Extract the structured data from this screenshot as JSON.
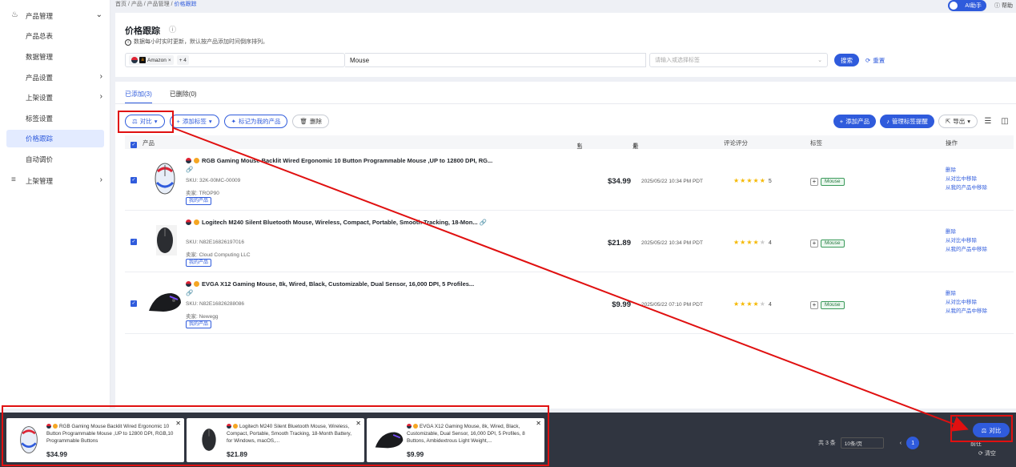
{
  "sidebar": {
    "group_top": {
      "label": "产品管理"
    },
    "items": [
      {
        "label": "产品总表"
      },
      {
        "label": "数据管理"
      },
      {
        "label": "产品设置"
      },
      {
        "label": "上架设置"
      },
      {
        "label": "标签设置"
      },
      {
        "label": "价格跟踪"
      },
      {
        "label": "自动调价"
      }
    ],
    "group_bottom": {
      "label": "上架管理"
    }
  },
  "breadcrumb": {
    "text": "首页 / 产品 / 产品管理 / ",
    "current": "价格跟踪"
  },
  "topright": {
    "ai_label": "AI助手",
    "help_label": "帮助"
  },
  "header": {
    "title": "价格跟踪",
    "notice": "数据每小时实时更新，默认按产品添加时间倒序排列。",
    "site_chip": "Amazon",
    "site_more": "+ 4",
    "keyword": "Mouse",
    "tag_placeholder": "请输入或选择标签",
    "search_label": "搜索",
    "reset_label": "重置"
  },
  "tabs": [
    {
      "label": "已添加(3)"
    },
    {
      "label": "已删除(0)"
    }
  ],
  "toolbar": {
    "compare_label": "对比",
    "add_tag_label": "添加标签",
    "mark_mine_label": "标记为我的产品",
    "delete_label": "删除",
    "add_product_label": "添加产品",
    "manage_alert_label": "管理标签提醒",
    "export_label": "导出"
  },
  "table": {
    "headers": {
      "product": "产品",
      "price": "当前价格",
      "time": "最后价格变动时间",
      "rating": "评论评分",
      "tags": "标签",
      "ops": "操作"
    },
    "rows": [
      {
        "title": "RGB Gaming Mouse Backlit Wired Ergonomic 10 Button Programmable Mouse ,UP to 12800 DPI, RG...",
        "sku": "SKU: 32K-00MC-00009",
        "seller": "卖家: TROP90",
        "mine": "我的产品",
        "price": "$34.99",
        "time": "2025/05/22 10:34 PM PDT",
        "rating": 5,
        "rating_label": "5",
        "tag": "Mouse",
        "ops": [
          "删除",
          "从对比中移除",
          "从我的产品中移除"
        ]
      },
      {
        "title": "Logitech M240 Silent Bluetooth Mouse, Wireless, Compact, Portable, Smooth Tracking, 18-Mon...",
        "sku": "SKU: N82E16826197016",
        "seller": "卖家: Cloud Computing LLC",
        "mine": "我的产品",
        "price": "$21.89",
        "time": "2025/05/22 10:34 PM PDT",
        "rating": 4,
        "rating_label": "4",
        "tag": "Mouse",
        "ops": [
          "删除",
          "从对比中移除",
          "从我的产品中移除"
        ]
      },
      {
        "title": "EVGA X12 Gaming Mouse, 8k, Wired, Black, Customizable, Dual Sensor, 16,000 DPI, 5 Profiles...",
        "sku": "SKU: N82E16826288086",
        "seller": "卖家: Newegg",
        "mine": "我的产品",
        "price": "$9.99",
        "time": "2025/05/22 07:10 PM PDT",
        "rating": 4,
        "rating_label": "4",
        "tag": "Mouse",
        "ops": [
          "删除",
          "从对比中移除",
          "从我的产品中移除"
        ]
      }
    ]
  },
  "compare_tray": {
    "cards": [
      {
        "title": "RGB Gaming Mouse Backlit Wired Ergonomic 10 Button Programmable Mouse ,UP to 12800 DPI, RGB,10 Programmable Buttons",
        "price": "$34.99"
      },
      {
        "title": "Logitech M240 Silent Bluetooth Mouse, Wireless, Compact, Portable, Smooth Tracking, 18-Month Battery, for Windows, macOS,...",
        "price": "$21.89"
      },
      {
        "title": "EVGA X12 Gaming Mouse, 8k, Wired, Black, Customizable, Dual Sensor, 16,000 DPI, 5 Profiles, 8 Buttons, Ambidextrous Light Weight,...",
        "price": "$9.99"
      }
    ],
    "total": "共 3 条",
    "page_size": "10条/页",
    "page": "1",
    "jump": "前往",
    "compare_label": "对比",
    "clear_label": "清空"
  },
  "colors": {
    "accent": "#2f5bdc",
    "annotation": "#e01010",
    "tray": "#303540"
  }
}
